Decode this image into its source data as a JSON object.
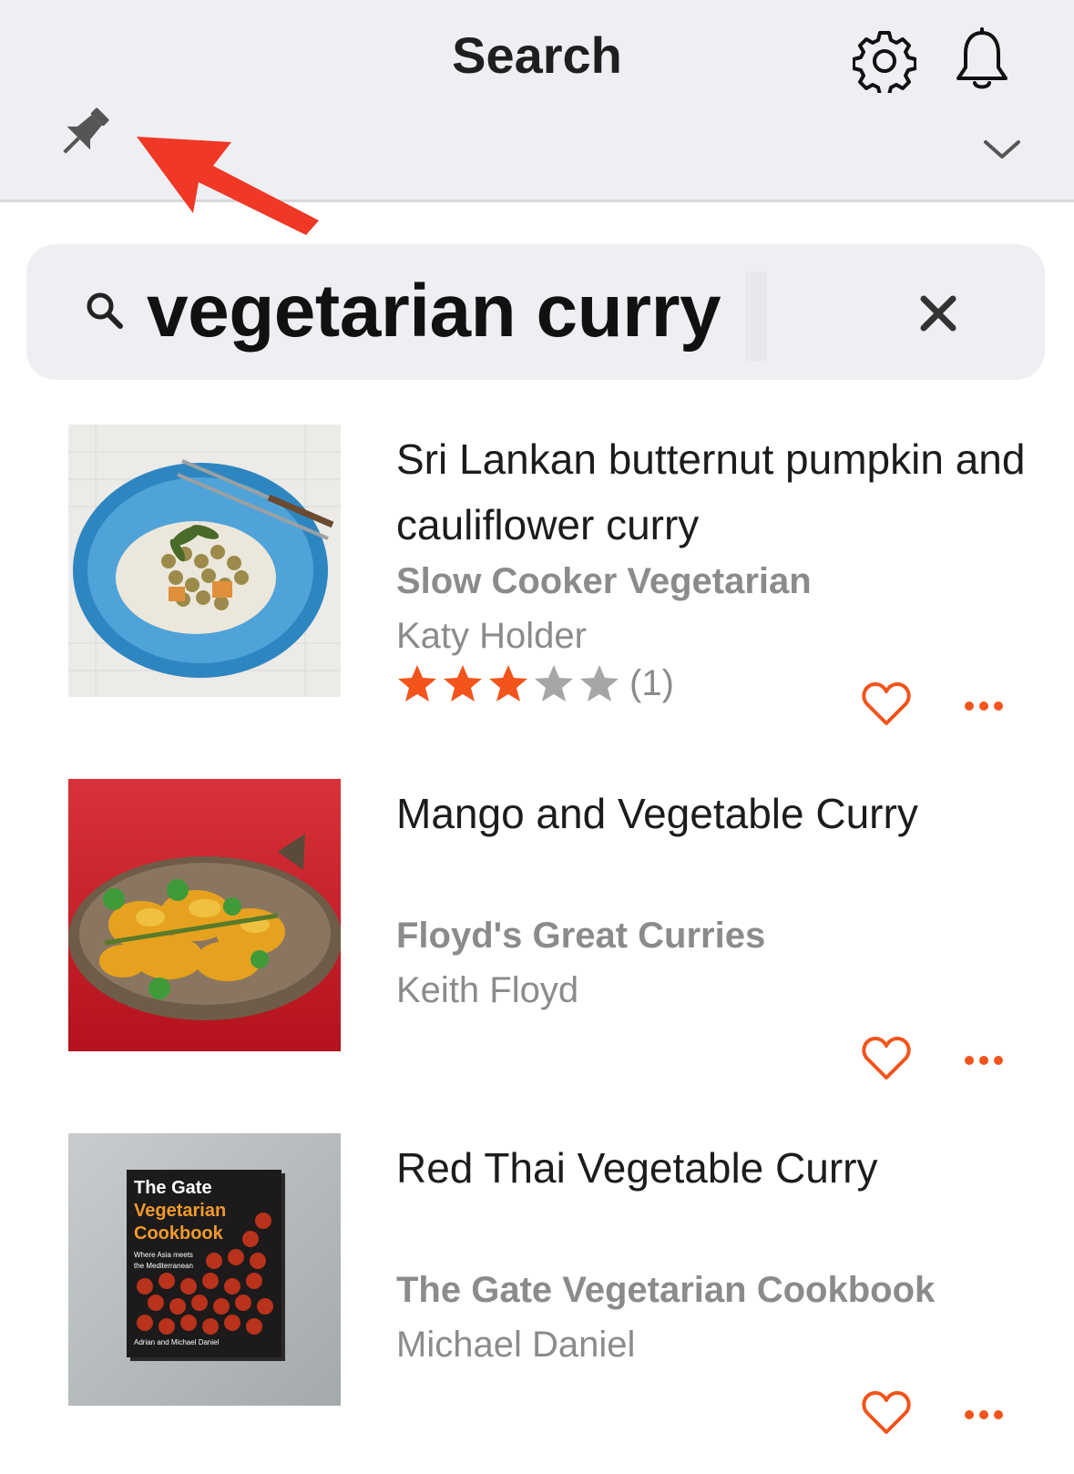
{
  "header": {
    "title": "Search",
    "icons": [
      "gear-icon",
      "bell-icon",
      "pin-icon",
      "chevron-down-icon"
    ]
  },
  "search": {
    "query": "vegetarian curry",
    "clear_icon": "close-icon"
  },
  "accent_color": "#f2541b",
  "results": [
    {
      "title": "Sri Lankan butternut pumpkin and cauliflower curry",
      "book": "Slow Cooker Vegetarian",
      "author": "Katy Holder",
      "rating": 3,
      "rating_max": 5,
      "rating_count": "(1)"
    },
    {
      "title": "Mango and Vegetable Curry",
      "book": "Floyd's Great Curries",
      "author": "Keith Floyd"
    },
    {
      "title": "Red Thai Vegetable Curry",
      "book": "The Gate Vegetarian Cookbook",
      "author": "Michael Daniel",
      "cover": {
        "line1": "The Gate",
        "line2": "Vegetarian",
        "line3": "Cookbook",
        "tagline1": "Where Asia meets",
        "tagline2": "the Mediterranean",
        "authors": "Adrian and Michael Daniel"
      }
    }
  ]
}
